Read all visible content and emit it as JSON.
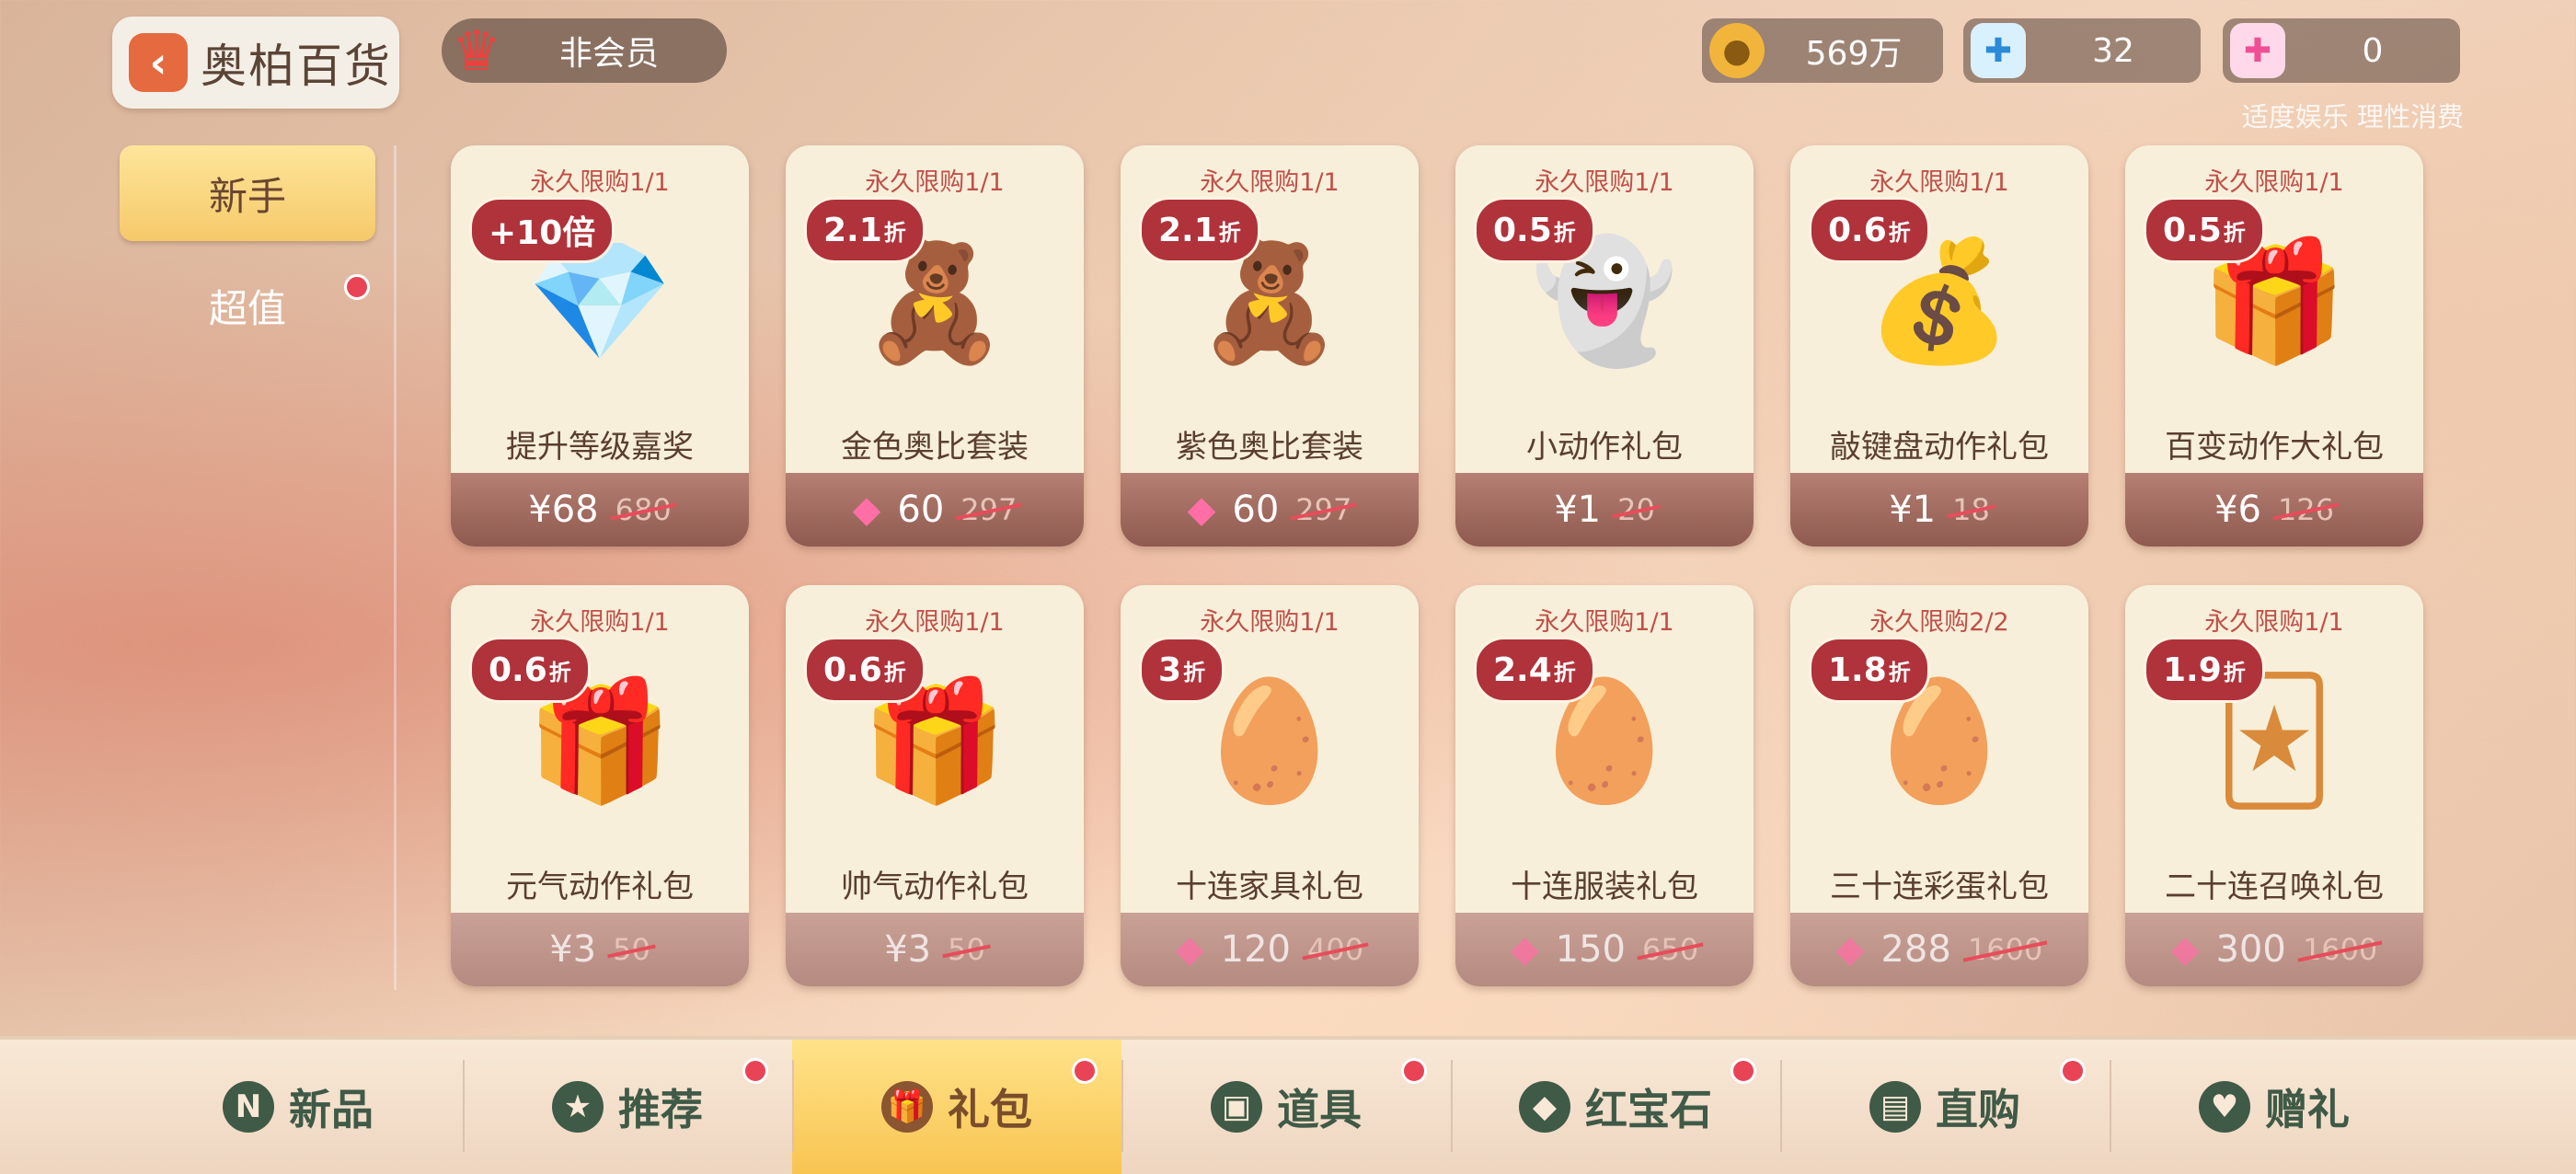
{
  "header": {
    "shop_title": "奥柏百货",
    "member_status": "非会员",
    "coins": "569万",
    "crystals": "32",
    "gems": "0",
    "notice": "适度娱乐 理性消费"
  },
  "left_nav": [
    {
      "label": "新手",
      "active": true,
      "dot": false
    },
    {
      "label": "超值",
      "active": false,
      "dot": true
    }
  ],
  "cards": [
    {
      "limit": "永久限购1/1",
      "badge_main": "+10倍",
      "badge_sub": "",
      "name": "提升等级嘉奖",
      "price": "¥68",
      "old_price": "680",
      "gem": false,
      "icon": "crystals-gift-icon"
    },
    {
      "limit": "永久限购1/1",
      "badge_main": "2.1",
      "badge_sub": "折",
      "name": "金色奥比套装",
      "price": "60",
      "old_price": "297",
      "gem": true,
      "icon": "gold-suit-icon"
    },
    {
      "limit": "永久限购1/1",
      "badge_main": "2.1",
      "badge_sub": "折",
      "name": "紫色奥比套装",
      "price": "60",
      "old_price": "297",
      "gem": true,
      "icon": "purple-suit-icon"
    },
    {
      "limit": "永久限购1/1",
      "badge_main": "0.5",
      "badge_sub": "折",
      "name": "小动作礼包",
      "price": "¥1",
      "old_price": "20",
      "gem": false,
      "icon": "ghost-icon"
    },
    {
      "limit": "永久限购1/1",
      "badge_main": "0.6",
      "badge_sub": "折",
      "name": "敲键盘动作礼包",
      "price": "¥1",
      "old_price": "18",
      "gem": false,
      "icon": "sack-icon"
    },
    {
      "limit": "永久限购1/1",
      "badge_main": "0.5",
      "badge_sub": "折",
      "name": "百变动作大礼包",
      "price": "¥6",
      "old_price": "126",
      "gem": false,
      "icon": "giftbox-icon"
    },
    {
      "limit": "永久限购1/1",
      "badge_main": "0.6",
      "badge_sub": "折",
      "name": "元气动作礼包",
      "price": "¥3",
      "old_price": "50",
      "gem": false,
      "icon": "giftbox-icon",
      "fade": true
    },
    {
      "limit": "永久限购1/1",
      "badge_main": "0.6",
      "badge_sub": "折",
      "name": "帅气动作礼包",
      "price": "¥3",
      "old_price": "50",
      "gem": false,
      "icon": "giftbox-icon",
      "fade": true
    },
    {
      "limit": "永久限购1/1",
      "badge_main": "3",
      "badge_sub": "折",
      "name": "十连家具礼包",
      "price": "120",
      "old_price": "400",
      "gem": true,
      "icon": "egg-cards-icon",
      "fade": true
    },
    {
      "limit": "永久限购1/1",
      "badge_main": "2.4",
      "badge_sub": "折",
      "name": "十连服装礼包",
      "price": "150",
      "old_price": "650",
      "gem": true,
      "icon": "egg-cards-icon",
      "fade": true
    },
    {
      "limit": "永久限购2/2",
      "badge_main": "1.8",
      "badge_sub": "折",
      "name": "三十连彩蛋礼包",
      "price": "288",
      "old_price": "1600",
      "gem": true,
      "icon": "egg-cards-icon",
      "fade": true
    },
    {
      "limit": "永久限购1/1",
      "badge_main": "1.9",
      "badge_sub": "折",
      "name": "二十连召唤礼包",
      "price": "300",
      "old_price": "1600",
      "gem": true,
      "icon": "summon-cards-icon",
      "fade": true
    }
  ],
  "tabs": [
    {
      "label": "新品",
      "icon": "N",
      "dot": false,
      "active": false
    },
    {
      "label": "推荐",
      "icon": "★",
      "dot": true,
      "active": false
    },
    {
      "label": "礼包",
      "icon": "🎁",
      "dot": true,
      "active": true
    },
    {
      "label": "道具",
      "icon": "▣",
      "dot": true,
      "active": false
    },
    {
      "label": "红宝石",
      "icon": "◆",
      "dot": true,
      "active": false
    },
    {
      "label": "直购",
      "icon": "▤",
      "dot": true,
      "active": false
    },
    {
      "label": "赠礼",
      "icon": "♥",
      "dot": false,
      "active": false
    }
  ]
}
